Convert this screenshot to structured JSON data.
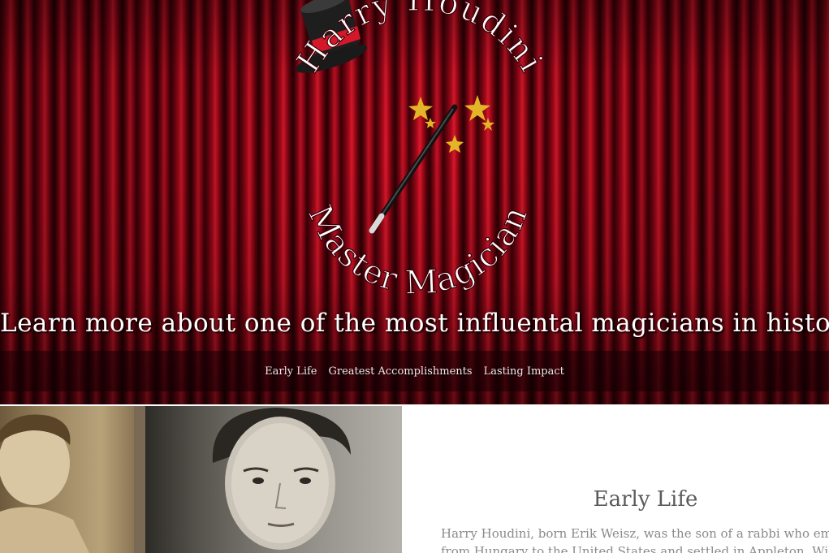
{
  "hero": {
    "logo_top_text": "Harry Houdini",
    "logo_bottom_text": "Master Magician",
    "tagline": "Learn more about one of the most influental magicians in history!"
  },
  "nav": {
    "items": [
      {
        "label": "Early Life"
      },
      {
        "label": "Greatest Accomplishments"
      },
      {
        "label": "Lasting Impact"
      }
    ]
  },
  "early_life": {
    "heading": "Early Life",
    "line1": "Harry Houdini, born Erik Weisz, was the son of a rabbi who emigrated",
    "line2": "from Hungary to the United States and settled in Appleton, Wisconsin"
  },
  "colors": {
    "curtain_red": "#c81225",
    "hat_band": "#d4182a",
    "star_gold": "#e2b626",
    "heading_gray": "#5b5b5b"
  },
  "icons": {
    "hat": "top-hat-icon",
    "wand": "magic-wand-icon",
    "star": "star-icon"
  }
}
